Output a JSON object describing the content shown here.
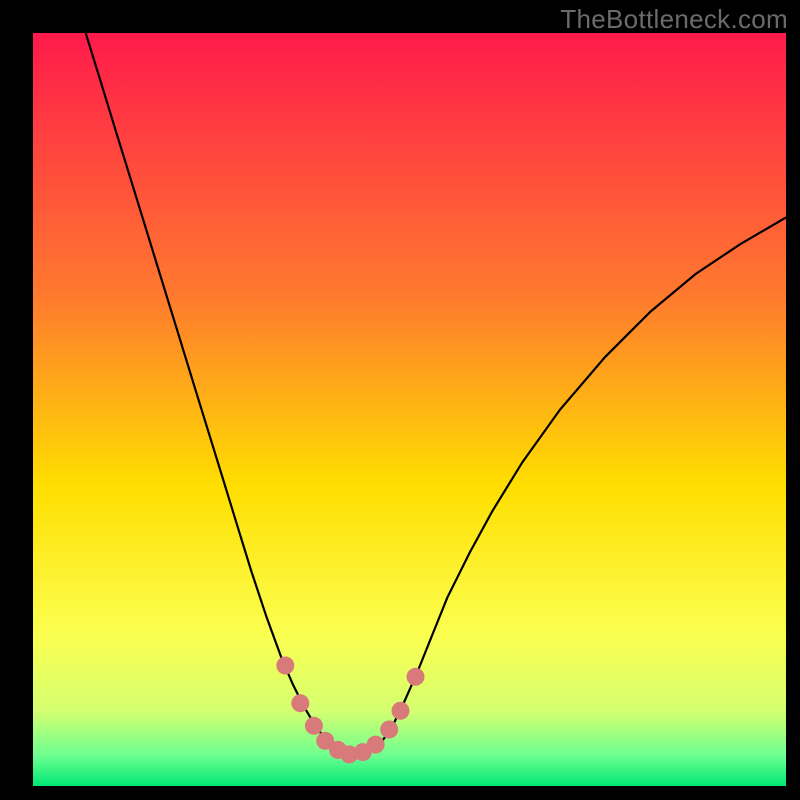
{
  "watermark": "TheBottleneck.com",
  "chart_data": {
    "type": "line",
    "title": "",
    "xlabel": "",
    "ylabel": "",
    "xlim": [
      0,
      1
    ],
    "ylim": [
      0,
      1
    ],
    "background_gradient": [
      {
        "stop": 0.0,
        "color": "#ff1a4b"
      },
      {
        "stop": 0.35,
        "color": "#ff7a2e"
      },
      {
        "stop": 0.6,
        "color": "#ffde00"
      },
      {
        "stop": 0.8,
        "color": "#fbff50"
      },
      {
        "stop": 0.9,
        "color": "#d4ff70"
      },
      {
        "stop": 0.96,
        "color": "#6cff90"
      },
      {
        "stop": 1.0,
        "color": "#00e874"
      }
    ],
    "series": [
      {
        "name": "bottleneck-curve",
        "type": "line",
        "color": "#000000",
        "x": [
          0.07,
          0.09,
          0.11,
          0.13,
          0.15,
          0.17,
          0.19,
          0.21,
          0.23,
          0.25,
          0.27,
          0.29,
          0.31,
          0.33,
          0.345,
          0.36,
          0.375,
          0.39,
          0.4,
          0.41,
          0.42,
          0.43,
          0.445,
          0.46,
          0.475,
          0.49,
          0.51,
          0.53,
          0.55,
          0.58,
          0.61,
          0.65,
          0.7,
          0.76,
          0.82,
          0.88,
          0.94,
          1.0
        ],
        "y": [
          1.0,
          0.935,
          0.87,
          0.805,
          0.74,
          0.675,
          0.61,
          0.545,
          0.48,
          0.415,
          0.35,
          0.285,
          0.225,
          0.17,
          0.135,
          0.105,
          0.08,
          0.06,
          0.05,
          0.045,
          0.042,
          0.042,
          0.045,
          0.055,
          0.075,
          0.105,
          0.15,
          0.2,
          0.25,
          0.31,
          0.365,
          0.43,
          0.5,
          0.57,
          0.63,
          0.68,
          0.72,
          0.755
        ]
      },
      {
        "name": "marker-dots",
        "type": "scatter",
        "color": "#d97a7a",
        "x": [
          0.335,
          0.355,
          0.373,
          0.388,
          0.405,
          0.42,
          0.438,
          0.455,
          0.473,
          0.488,
          0.508
        ],
        "y": [
          0.16,
          0.11,
          0.08,
          0.06,
          0.048,
          0.042,
          0.045,
          0.055,
          0.075,
          0.1,
          0.145
        ]
      }
    ]
  }
}
